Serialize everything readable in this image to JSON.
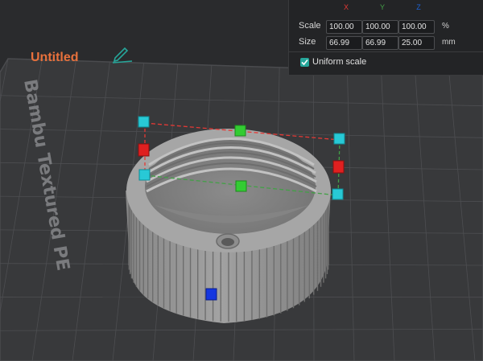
{
  "plate": {
    "name": "Untitled",
    "bed_label": "Bambu Textured PE",
    "name_color": "#e8713c",
    "accent_color": "#26a69a"
  },
  "scale_panel": {
    "axes": [
      {
        "label": "X",
        "color": "#e53935"
      },
      {
        "label": "Y",
        "color": "#43a047"
      },
      {
        "label": "Z",
        "color": "#1e63d6"
      }
    ],
    "scale": {
      "label": "Scale",
      "x": "100.00",
      "y": "100.00",
      "z": "100.00",
      "unit": "%"
    },
    "size": {
      "label": "Size",
      "x": "66.99",
      "y": "66.99",
      "z": "25.00",
      "unit": "mm"
    },
    "uniform_scale": {
      "label": "Uniform scale",
      "checked": true
    }
  },
  "icons": {
    "edit": "pencil-icon",
    "checkbox": "check-icon"
  }
}
